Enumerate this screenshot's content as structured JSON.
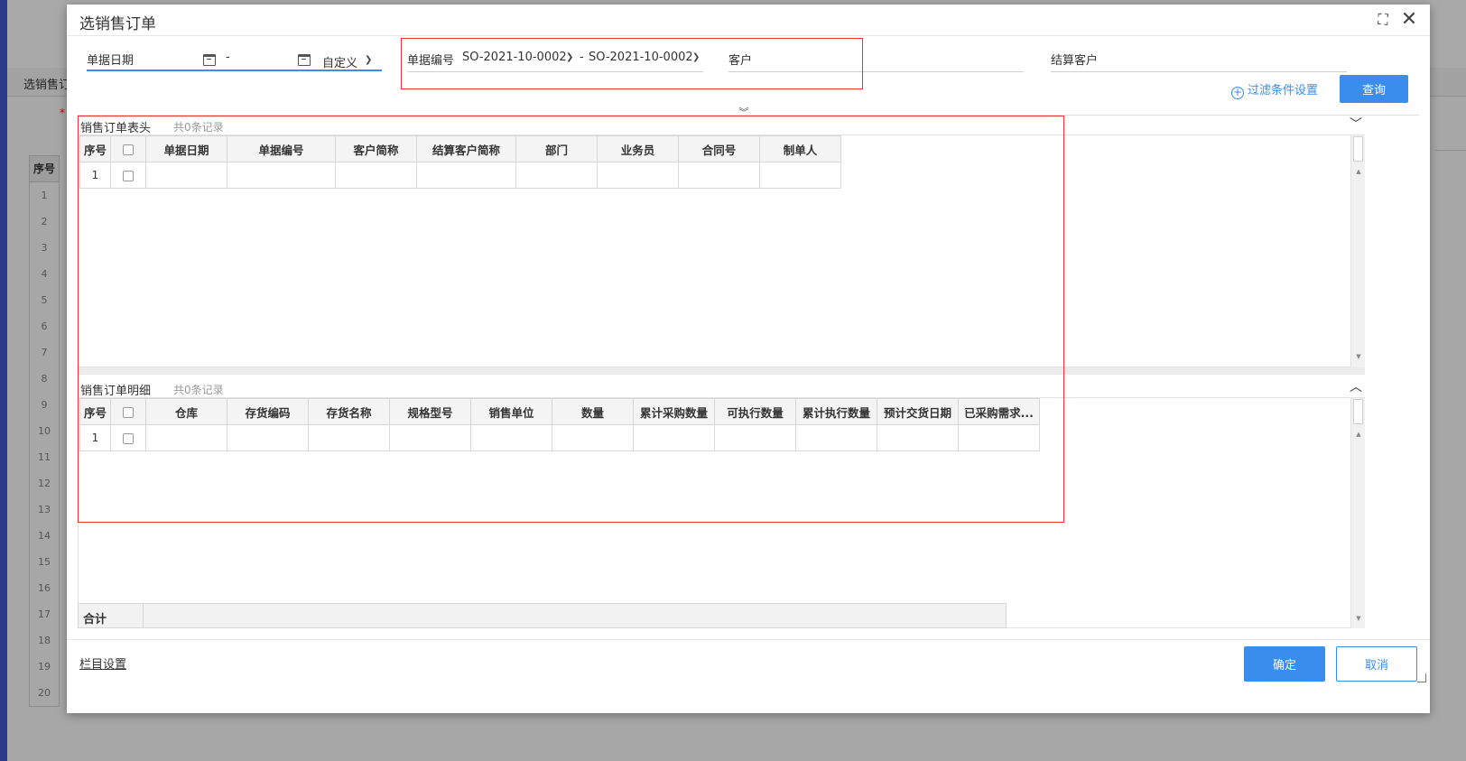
{
  "background": {
    "tab_label": "选销售订",
    "required_mark": "*",
    "grid_header": "序号",
    "row_numbers": [
      "1",
      "2",
      "3",
      "4",
      "5",
      "6",
      "7",
      "8",
      "9",
      "10",
      "11",
      "12",
      "13",
      "14",
      "15",
      "16",
      "17",
      "18",
      "19",
      "20"
    ]
  },
  "dialog": {
    "title": "选销售订单",
    "maximize_icon": "⛶",
    "close_icon": "✕"
  },
  "filters": {
    "date_label": "单据日期",
    "date_separator": "-",
    "date_mode": "自定义",
    "bill_no_label": "单据编号",
    "bill_no_from": "SO-2021-10-0002",
    "bill_no_separator": "-",
    "bill_no_to": "SO-2021-10-0002",
    "customer_label": "客户",
    "settle_customer_label": "结算客户",
    "filter_settings_label": "过滤条件设置",
    "query_label": "查询",
    "collapse_icon": "︾"
  },
  "header_section": {
    "title": "销售订单表头",
    "count_text": "共0条记录",
    "toggle_icon": "﹀",
    "columns": [
      "序号",
      "",
      "单据日期",
      "单据编号",
      "客户简称",
      "结算客户简称",
      "部门",
      "业务员",
      "合同号",
      "制单人"
    ],
    "rows": [
      [
        "1",
        "",
        "",
        "",
        "",
        "",
        "",
        "",
        "",
        ""
      ]
    ]
  },
  "detail_section": {
    "title": "销售订单明细",
    "count_text": "共0条记录",
    "toggle_icon": "︿",
    "columns": [
      "序号",
      "",
      "仓库",
      "存货编码",
      "存货名称",
      "规格型号",
      "销售单位",
      "数量",
      "累计采购数量",
      "可执行数量",
      "累计执行数量",
      "预计交货日期",
      "已采购需求..."
    ],
    "rows": [
      [
        "1",
        "",
        "",
        "",
        "",
        "",
        "",
        "",
        "",
        "",
        "",
        "",
        ""
      ]
    ],
    "total_label": "合计"
  },
  "footer": {
    "column_settings_label": "栏目设置",
    "ok_label": "确定",
    "cancel_label": "取消"
  },
  "colors": {
    "accent": "#3b8ded",
    "highlight_box": "#e53935"
  }
}
